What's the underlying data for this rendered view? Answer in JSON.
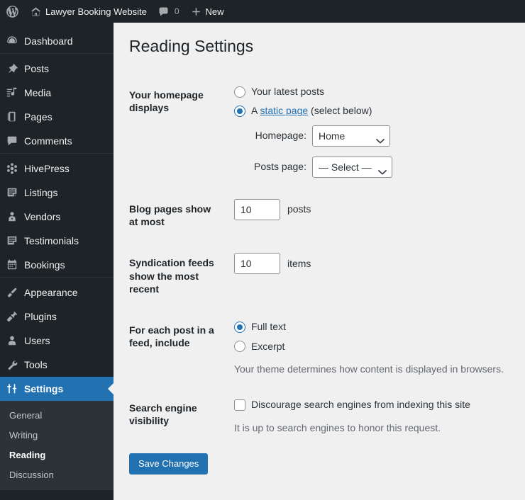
{
  "adminbar": {
    "logo_icon": "wordpress-logo-icon",
    "site_icon": "home-icon",
    "site_name": "Lawyer Booking Website",
    "comments_icon": "comment-bubble-icon",
    "comments_count": "0",
    "new_icon": "plus-icon",
    "new_label": "New"
  },
  "sidebar": {
    "items": [
      {
        "label": "Dashboard",
        "icon": "dashboard-icon",
        "key": "dashboard"
      },
      {
        "label": "Posts",
        "icon": "pin-icon",
        "key": "posts"
      },
      {
        "label": "Media",
        "icon": "media-icon",
        "key": "media"
      },
      {
        "label": "Pages",
        "icon": "pages-icon",
        "key": "pages"
      },
      {
        "label": "Comments",
        "icon": "comment-bubble-icon",
        "key": "comments"
      },
      {
        "label": "HivePress",
        "icon": "hivepress-icon",
        "key": "hivepress"
      },
      {
        "label": "Listings",
        "icon": "listings-icon",
        "key": "listings"
      },
      {
        "label": "Vendors",
        "icon": "vendor-user-icon",
        "key": "vendors"
      },
      {
        "label": "Testimonials",
        "icon": "testimonials-icon",
        "key": "testimonials"
      },
      {
        "label": "Bookings",
        "icon": "calendar-icon",
        "key": "bookings"
      },
      {
        "label": "Appearance",
        "icon": "paintbrush-icon",
        "key": "appearance"
      },
      {
        "label": "Plugins",
        "icon": "plugin-icon",
        "key": "plugins"
      },
      {
        "label": "Users",
        "icon": "user-icon",
        "key": "users"
      },
      {
        "label": "Tools",
        "icon": "wrench-icon",
        "key": "tools"
      },
      {
        "label": "Settings",
        "icon": "settings-sliders-icon",
        "key": "settings"
      }
    ],
    "submenu": [
      {
        "label": "General"
      },
      {
        "label": "Writing"
      },
      {
        "label": "Reading"
      },
      {
        "label": "Discussion"
      }
    ],
    "active_item": "Settings",
    "active_subitem": "Reading",
    "accent_color": "#2271b1",
    "background_color": "#1d2327",
    "submenu_background_color": "#2c3338"
  },
  "main": {
    "page_title": "Reading Settings",
    "rows": {
      "homepage_displays": {
        "label": "Your homepage displays",
        "option_latest_posts": "Your latest posts",
        "option_static_prefix": "A ",
        "option_static_link": "static page",
        "option_static_suffix": " (select below)",
        "selected": "static",
        "homepage_label": "Homepage:",
        "homepage_value": "Home",
        "posts_page_label": "Posts page:",
        "posts_page_value": "— Select —"
      },
      "blog_pages": {
        "label": "Blog pages show at most",
        "value": "10",
        "unit": "posts"
      },
      "syndication_feeds": {
        "label": "Syndication feeds show the most recent",
        "value": "10",
        "unit": "items"
      },
      "feed_include": {
        "label": "For each post in a feed, include",
        "option_full_text": "Full text",
        "option_excerpt": "Excerpt",
        "selected": "full_text",
        "description": "Your theme determines how content is displayed in browsers."
      },
      "search_visibility": {
        "label": "Search engine visibility",
        "checkbox_label": "Discourage search engines from indexing this site",
        "checked": false,
        "description": "It is up to search engines to honor this request."
      }
    },
    "save_button": "Save Changes"
  }
}
